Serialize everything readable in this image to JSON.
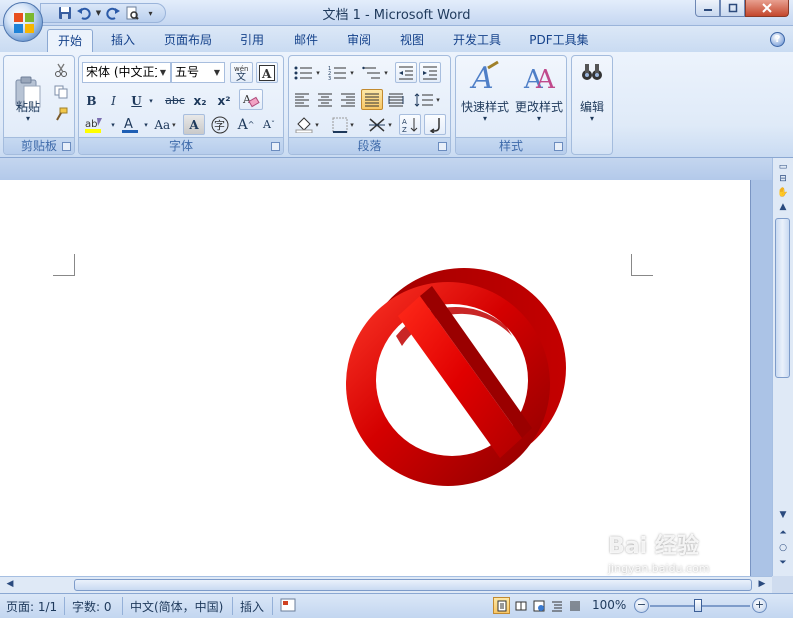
{
  "window": {
    "title": "文档 1 - Microsoft Word"
  },
  "tabs": [
    {
      "label": "开始",
      "active": true
    },
    {
      "label": "插入"
    },
    {
      "label": "页面布局"
    },
    {
      "label": "引用"
    },
    {
      "label": "邮件"
    },
    {
      "label": "审阅"
    },
    {
      "label": "视图"
    },
    {
      "label": "开发工具"
    },
    {
      "label": "PDF工具集"
    }
  ],
  "ribbon": {
    "clipboard": {
      "group_label": "剪贴板",
      "paste_label": "粘贴"
    },
    "font": {
      "group_label": "字体",
      "font_name": "宋体 (中文正文",
      "font_size": "五号",
      "bold": "B",
      "italic": "I",
      "underline": "U",
      "strike": "abc",
      "subscript": "x₂",
      "superscript": "x²",
      "change_case": "Aa",
      "grow": "A",
      "shrink": "A",
      "char_shading": "A",
      "enclose": "字",
      "clear_format": "A"
    },
    "paragraph": {
      "group_label": "段落"
    },
    "styles": {
      "group_label": "样式",
      "quick_styles": "快速样式",
      "change_styles": "更改样式"
    },
    "editing": {
      "edit_label": "编辑"
    }
  },
  "statusbar": {
    "page": "页面: 1/1",
    "words": "字数: 0",
    "language": "中文(简体，中国)",
    "mode": "插入",
    "zoom": "100%",
    "zoom_percent": 100
  },
  "document": {
    "content": "prohibition-sign-graphic"
  },
  "watermark": {
    "text": "Bai 经验",
    "url": "jingyan.baidu.com"
  },
  "colors": {
    "sign_red": "#d40000",
    "sign_dark": "#9a0000",
    "ribbon_text": "#15428b"
  }
}
